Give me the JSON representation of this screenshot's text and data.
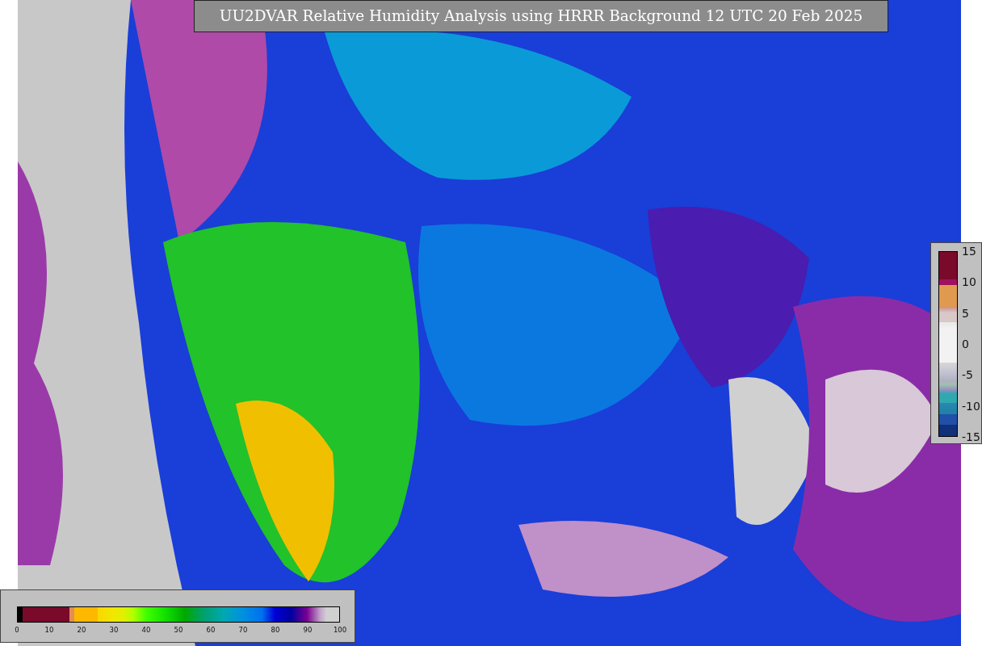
{
  "map": {
    "title": "UU2DVAR Relative Humidity Analysis using HRRR Background 12 UTC 20 Feb 2025",
    "kind": "picture"
  },
  "humidity_colorbar": {
    "ticks": [
      "0",
      "10",
      "20",
      "30",
      "40",
      "50",
      "60",
      "70",
      "80",
      "90",
      "100"
    ]
  },
  "difference_colorbar": {
    "ticks": [
      "15",
      "10",
      "5",
      "0",
      "-5",
      "-10",
      "-15"
    ]
  }
}
